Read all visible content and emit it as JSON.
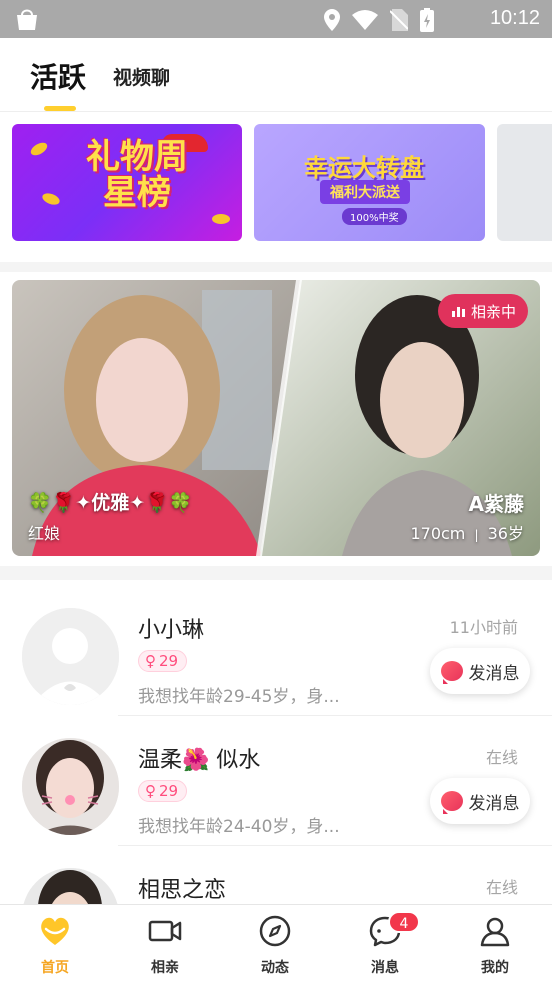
{
  "status_bar": {
    "time": "10:12",
    "icons": [
      "location-icon",
      "wifi-icon",
      "no-sim-icon",
      "battery-charging-icon"
    ]
  },
  "header": {
    "tabs": [
      {
        "label": "活跃",
        "active": true
      },
      {
        "label": "视频聊",
        "active": false
      }
    ]
  },
  "banners": [
    {
      "title": "礼物周星榜",
      "icon": "gift-week-star-banner"
    },
    {
      "title": "幸运大转盘",
      "subtitle": "福利大派送",
      "pill": "100%中奖"
    },
    {
      "title": ""
    }
  ],
  "featured": {
    "badge": "相亲中",
    "left": {
      "name": "🍀🌹✦优雅✦🌹🍀",
      "role": "红娘"
    },
    "right": {
      "name": "A紫藤",
      "height": "170cm",
      "age": "36岁",
      "separator": "|"
    }
  },
  "users": [
    {
      "name": "小小琳",
      "time": "11小时前",
      "age": "29",
      "desc": "我想找年龄29-45岁，身...",
      "has_button": true,
      "avatar": "default-avatar"
    },
    {
      "name": "温柔🌺 似水",
      "time": "在线",
      "age": "29",
      "desc": "我想找年龄24-40岁，身...",
      "has_button": true,
      "avatar": "photo-avatar"
    },
    {
      "name": "相思之恋",
      "time": "在线",
      "age": "",
      "desc": "",
      "has_button": false,
      "avatar": "photo-avatar"
    }
  ],
  "message_button_label": "发消息",
  "bottom_nav": [
    {
      "label": "首页",
      "icon": "heart-home-icon",
      "active": true
    },
    {
      "label": "相亲",
      "icon": "video-camera-icon",
      "active": false
    },
    {
      "label": "动态",
      "icon": "compass-icon",
      "active": false
    },
    {
      "label": "消息",
      "icon": "chat-bubble-icon",
      "active": false,
      "badge": "4"
    },
    {
      "label": "我的",
      "icon": "person-icon",
      "active": false
    }
  ],
  "colors": {
    "accent_yellow": "#ffcf2e",
    "active_nav": "#f5a623",
    "live_badge": "#e0325c",
    "badge_red": "#f2374b",
    "age_pink": "#ff4d7d"
  }
}
